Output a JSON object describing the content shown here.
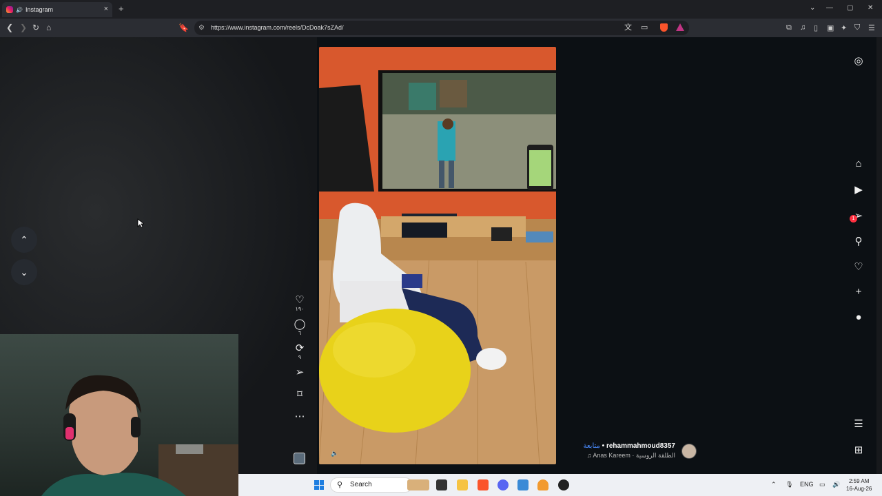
{
  "browser": {
    "tab_title": "Instagram",
    "tab_close": "×",
    "new_tab": "+",
    "url": "https://www.instagram.com/reels/DcDoak7sZAd/",
    "window_controls": [
      "⌄",
      "—",
      "▢",
      "✕"
    ]
  },
  "reel": {
    "likes": "١٩٠",
    "comments": "٦",
    "reposts": "٩",
    "username": "rehammahmoud8357",
    "follow_label": "متابعة",
    "separator": "•",
    "audio": "Anas Kareem · الطلقة الروسية"
  },
  "nav_buttons": {
    "up": "⌃",
    "down": "⌄"
  },
  "right_nav": {
    "messages_badge": "1"
  },
  "taskbar": {
    "search_placeholder": "Search",
    "language": "ENG",
    "time": "2:59 AM",
    "date": "16-Aug-26"
  },
  "colors": {
    "background": "#0c1014",
    "wall_orange": "#d9582e",
    "beanbag_yellow": "#e8d21a",
    "follow_blue": "#4a8cff",
    "badge_red": "#ff3040"
  },
  "icons": [
    "instagram-icon",
    "home-icon",
    "reels-icon",
    "messages-icon",
    "search-icon",
    "heart-icon",
    "plus-icon",
    "profile-icon",
    "menu-icon",
    "apps-icon",
    "like-icon",
    "comment-icon",
    "repost-icon",
    "share-icon",
    "bookmark-icon",
    "more-icon",
    "volume-icon"
  ]
}
